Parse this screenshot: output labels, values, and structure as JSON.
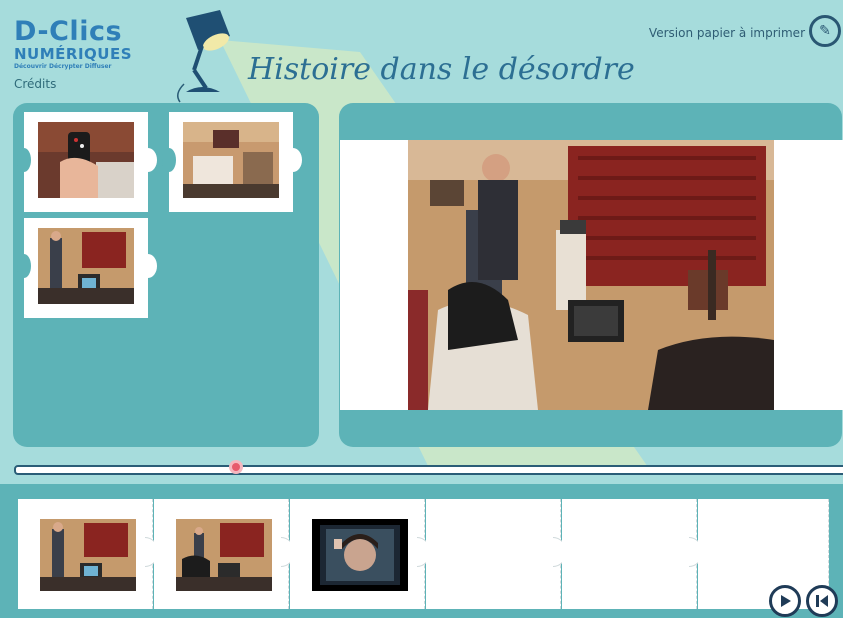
{
  "header": {
    "logo_line1": "D-Clics",
    "logo_line2": "NUMÉRIQUES",
    "logo_line3": "Découvrir Décrypter Diffuser",
    "credits": "Crédits",
    "title": "Histoire dans le désordre",
    "print_label": "Version papier à imprimer",
    "print_icon": "edit-icon"
  },
  "colors": {
    "background": "#a6dcdc",
    "panel": "#5db3b7",
    "accent": "#e75a6b",
    "title": "#2c6f93"
  },
  "cards": [
    {
      "name": "tv-remote-scene"
    },
    {
      "name": "living-room-empty-scene"
    },
    {
      "name": "man-standing-scene"
    }
  ],
  "timeline_slots": [
    {
      "filled": true,
      "name": "man-standing-scene"
    },
    {
      "filled": true,
      "name": "couple-tv-scene"
    },
    {
      "filled": true,
      "name": "face-on-screen-scene"
    },
    {
      "filled": false
    },
    {
      "filled": false
    },
    {
      "filled": false
    }
  ],
  "slider": {
    "value_fraction": 0.27
  },
  "nav": {
    "play_icon": "play-icon",
    "rewind_icon": "skip-back-icon"
  }
}
